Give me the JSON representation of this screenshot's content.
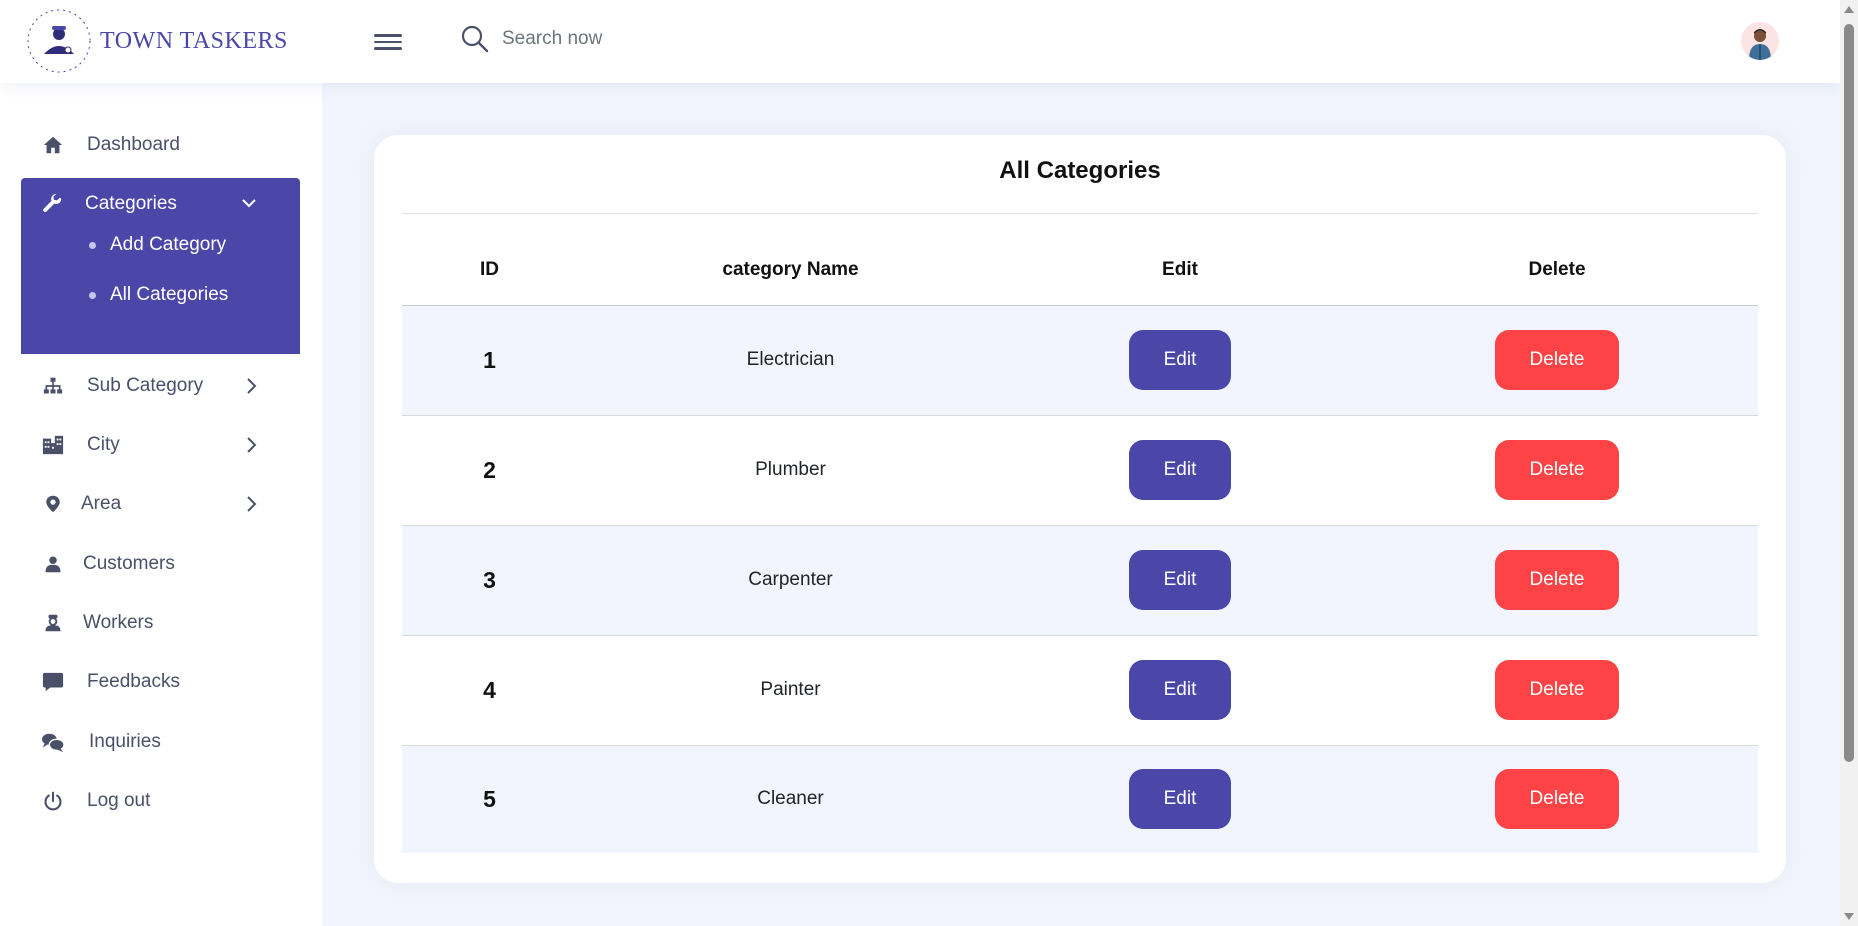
{
  "header": {
    "brand": "TOWN TASKERS",
    "search_placeholder": "Search now"
  },
  "sidebar": {
    "items": [
      {
        "label": "Dashboard",
        "icon": "home-icon"
      },
      {
        "label": "Categories",
        "icon": "wrench-icon"
      },
      {
        "label": "Sub Category",
        "icon": "sitemap-icon"
      },
      {
        "label": "City",
        "icon": "city-icon"
      },
      {
        "label": "Area",
        "icon": "map-pin-icon"
      },
      {
        "label": "Customers",
        "icon": "user-icon"
      },
      {
        "label": "Workers",
        "icon": "worker-icon"
      },
      {
        "label": "Feedbacks",
        "icon": "comment-icon"
      },
      {
        "label": "Inquiries",
        "icon": "comments-icon"
      },
      {
        "label": "Log out",
        "icon": "power-icon"
      }
    ],
    "categories_sub": [
      {
        "label": "Add Category"
      },
      {
        "label": "All Categories"
      }
    ]
  },
  "main": {
    "title": "All Categories",
    "columns": [
      "ID",
      "category Name",
      "Edit",
      "Delete"
    ],
    "rows": [
      {
        "id": "1",
        "name": "Electrician",
        "edit": "Edit",
        "delete": "Delete"
      },
      {
        "id": "2",
        "name": "Plumber",
        "edit": "Edit",
        "delete": "Delete"
      },
      {
        "id": "3",
        "name": "Carpenter",
        "edit": "Edit",
        "delete": "Delete"
      },
      {
        "id": "4",
        "name": "Painter",
        "edit": "Edit",
        "delete": "Delete"
      },
      {
        "id": "5",
        "name": "Cleaner",
        "edit": "Edit",
        "delete": "Delete"
      }
    ]
  },
  "colors": {
    "accent": "#4b47a9",
    "danger": "#fd4346",
    "page_bg": "#f2f5fd"
  }
}
